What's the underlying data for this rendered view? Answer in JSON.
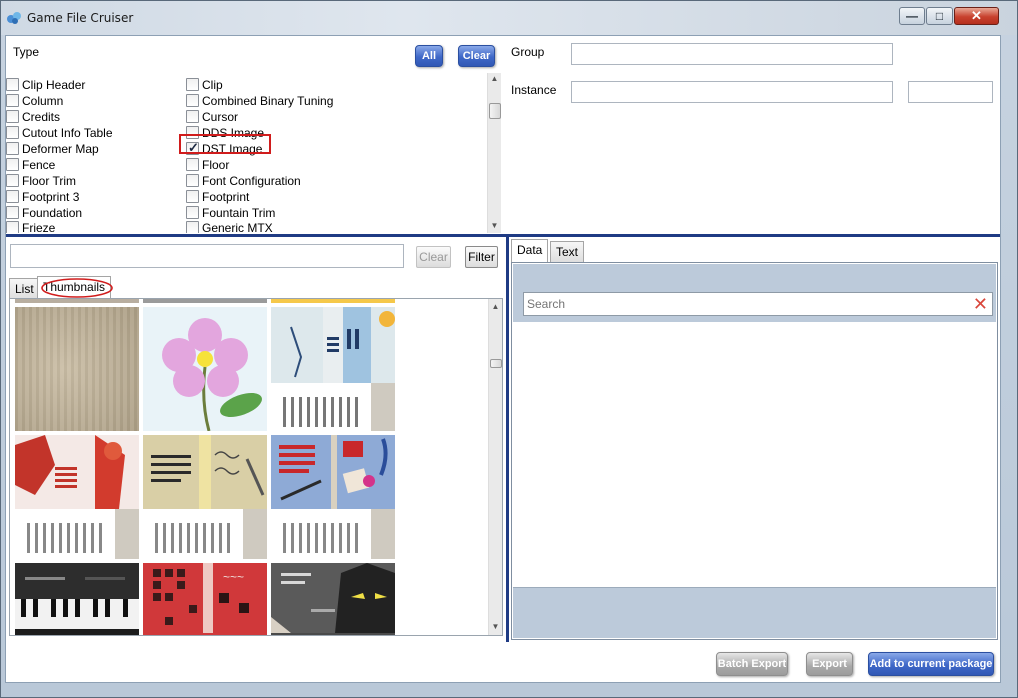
{
  "window": {
    "title": "Game File Cruiser",
    "controls": {
      "minimize": "—",
      "maximize": "□",
      "close": "✕"
    }
  },
  "types": {
    "label": "Type",
    "all_label": "All",
    "clear_label": "Clear",
    "col1": [
      {
        "label": "Clip Header",
        "checked": false
      },
      {
        "label": "Column",
        "checked": false
      },
      {
        "label": "Credits",
        "checked": false
      },
      {
        "label": "Cutout Info Table",
        "checked": false
      },
      {
        "label": "Deformer Map",
        "checked": false
      },
      {
        "label": "Fence",
        "checked": false
      },
      {
        "label": "Floor Trim",
        "checked": false
      },
      {
        "label": "Footprint 3",
        "checked": false
      },
      {
        "label": "Foundation",
        "checked": false
      },
      {
        "label": "Frieze",
        "checked": false
      }
    ],
    "col2": [
      {
        "label": "Clip",
        "checked": false
      },
      {
        "label": "Combined Binary Tuning",
        "checked": false
      },
      {
        "label": "Cursor",
        "checked": false
      },
      {
        "label": "DDS Image",
        "checked": false
      },
      {
        "label": "DST Image",
        "checked": true
      },
      {
        "label": "Floor",
        "checked": false
      },
      {
        "label": "Font Configuration",
        "checked": false
      },
      {
        "label": "Footprint",
        "checked": false
      },
      {
        "label": "Fountain Trim",
        "checked": false
      },
      {
        "label": "Generic MTX",
        "checked": false
      }
    ]
  },
  "group": {
    "label": "Group",
    "value": ""
  },
  "instance": {
    "label": "Instance",
    "value": "",
    "extra_value": ""
  },
  "filter": {
    "value": "",
    "clear_label": "Clear",
    "filter_label": "Filter"
  },
  "left_tabs": [
    {
      "label": "List"
    },
    {
      "label": "Thumbnails"
    }
  ],
  "right_tabs": [
    {
      "label": "Data"
    },
    {
      "label": "Text"
    }
  ],
  "search": {
    "placeholder": "Search"
  },
  "footer": {
    "batch_export_label": "Batch Export",
    "export_label": "Export",
    "add_label": "Add to current package"
  },
  "colors": {
    "accent": "#3f68c8",
    "divider": "#1f3b84",
    "highlight": "#d01c1c"
  }
}
